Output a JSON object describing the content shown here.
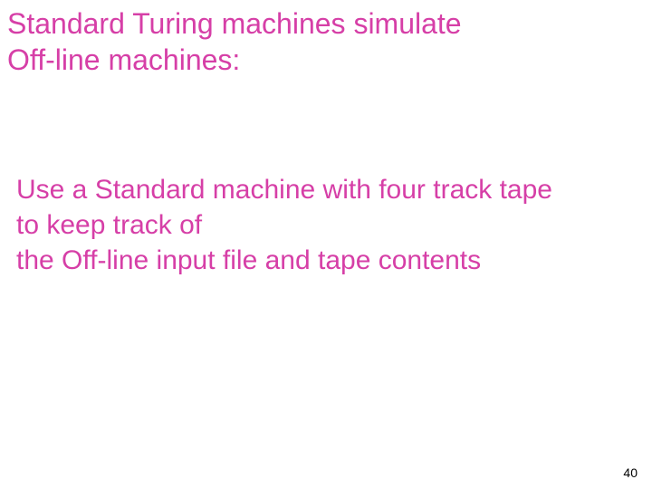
{
  "slide": {
    "title_line1": "Standard Turing machines simulate",
    "title_line2": "Off-line machines:",
    "body_line1": "Use a Standard machine with four track tape",
    "body_line2": "to keep track of",
    "body_line3": "the Off-line input file and tape contents",
    "page_number": "40"
  }
}
